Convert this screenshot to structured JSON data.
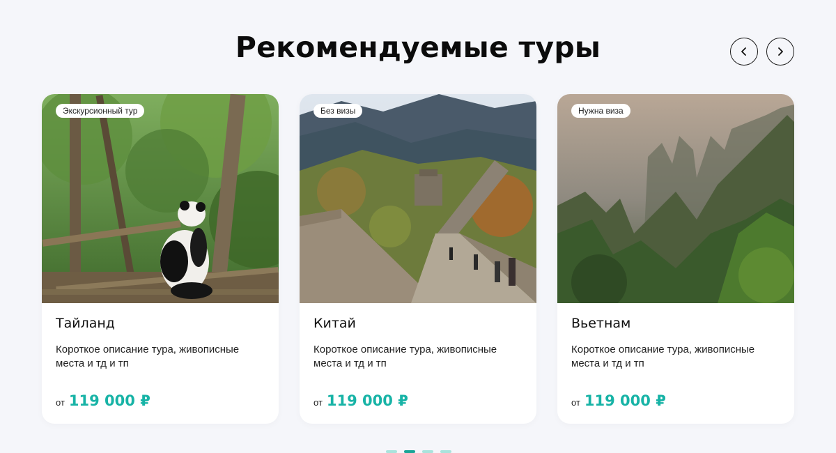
{
  "section": {
    "title": "Рекомендуемые туры",
    "prev_label": "previous",
    "next_label": "next"
  },
  "cards": [
    {
      "badge": "Экскурсионный тур",
      "title": "Тайланд",
      "description": "Короткое описание тура, живописные места и тд и тп",
      "price_prefix": "от",
      "price": "119 000 ₽",
      "image": "panda-in-forest"
    },
    {
      "badge": "Без визы",
      "title": "Китай",
      "description": "Короткое описание тура, живописные места и тд и тп",
      "price_prefix": "от",
      "price": "119 000 ₽",
      "image": "great-wall"
    },
    {
      "badge": "Нужна виза",
      "title": "Вьетнам",
      "description": "Короткое описание тура, живописные места и тд и тп",
      "price_prefix": "от",
      "price": "119 000 ₽",
      "image": "karst-mountains"
    }
  ],
  "pagination": {
    "pages": 4,
    "active_index": 1
  },
  "colors": {
    "accent": "#17b3a6",
    "background": "#f5f6fa"
  }
}
